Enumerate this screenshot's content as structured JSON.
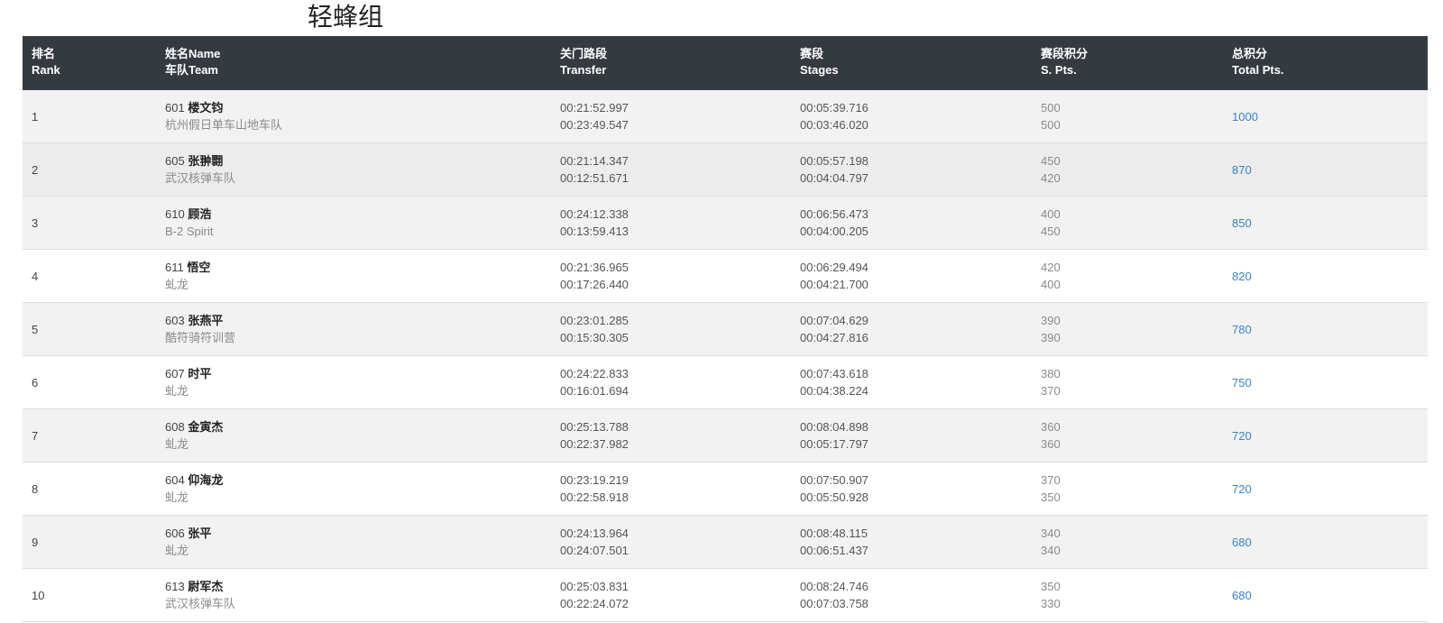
{
  "page": {
    "title": "轻蜂组"
  },
  "columns": {
    "rank_cn": "排名",
    "rank_en": "Rank",
    "name_cn": "姓名Name",
    "team_cn": "车队Team",
    "transfer_cn": "关门路段",
    "transfer_en": "Transfer",
    "stages_cn": "赛段",
    "stages_en": "Stages",
    "spts_cn": "赛段积分",
    "spts_en": "S. Pts.",
    "total_cn": "总积分",
    "total_en": "Total Pts."
  },
  "colors": {
    "header_bg": "#343a40",
    "link": "#3b82c4",
    "row_shade": "#f2f2f2"
  },
  "rows": [
    {
      "rank": "1",
      "bib": "601",
      "name": "楼文钧",
      "team": "杭州假日单车山地车队",
      "transfer1": "00:21:52.997",
      "transfer2": "00:23:49.547",
      "stage1": "00:05:39.716",
      "stage2": "00:03:46.020",
      "spts1": "500",
      "spts2": "500",
      "total": "1000"
    },
    {
      "rank": "2",
      "bib": "605",
      "name": "张翀翾",
      "team": "武汉核弹车队",
      "transfer1": "00:21:14.347",
      "transfer2": "00:12:51.671",
      "stage1": "00:05:57.198",
      "stage2": "00:04:04.797",
      "spts1": "450",
      "spts2": "420",
      "total": "870"
    },
    {
      "rank": "3",
      "bib": "610",
      "name": "顾浩",
      "team": "B-2 Spirit",
      "transfer1": "00:24:12.338",
      "transfer2": "00:13:59.413",
      "stage1": "00:06:56.473",
      "stage2": "00:04:00.205",
      "spts1": "400",
      "spts2": "450",
      "total": "850"
    },
    {
      "rank": "4",
      "bib": "611",
      "name": "悟空",
      "team": "虬龙",
      "transfer1": "00:21:36.965",
      "transfer2": "00:17:26.440",
      "stage1": "00:06:29.494",
      "stage2": "00:04:21.700",
      "spts1": "420",
      "spts2": "400",
      "total": "820"
    },
    {
      "rank": "5",
      "bib": "603",
      "name": "张燕平",
      "team": "酷符骑符训营",
      "transfer1": "00:23:01.285",
      "transfer2": "00:15:30.305",
      "stage1": "00:07:04.629",
      "stage2": "00:04:27.816",
      "spts1": "390",
      "spts2": "390",
      "total": "780"
    },
    {
      "rank": "6",
      "bib": "607",
      "name": "时平",
      "team": "虬龙",
      "transfer1": "00:24:22.833",
      "transfer2": "00:16:01.694",
      "stage1": "00:07:43.618",
      "stage2": "00:04:38.224",
      "spts1": "380",
      "spts2": "370",
      "total": "750"
    },
    {
      "rank": "7",
      "bib": "608",
      "name": "金寅杰",
      "team": "虬龙",
      "transfer1": "00:25:13.788",
      "transfer2": "00:22:37.982",
      "stage1": "00:08:04.898",
      "stage2": "00:05:17.797",
      "spts1": "360",
      "spts2": "360",
      "total": "720"
    },
    {
      "rank": "8",
      "bib": "604",
      "name": "仰海龙",
      "team": "虬龙",
      "transfer1": "00:23:19.219",
      "transfer2": "00:22:58.918",
      "stage1": "00:07:50.907",
      "stage2": "00:05:50.928",
      "spts1": "370",
      "spts2": "350",
      "total": "720"
    },
    {
      "rank": "9",
      "bib": "606",
      "name": "张平",
      "team": "虬龙",
      "transfer1": "00:24:13.964",
      "transfer2": "00:24:07.501",
      "stage1": "00:08:48.115",
      "stage2": "00:06:51.437",
      "spts1": "340",
      "spts2": "340",
      "total": "680"
    },
    {
      "rank": "10",
      "bib": "613",
      "name": "尉军杰",
      "team": "武汉核弹车队",
      "transfer1": "00:25:03.831",
      "transfer2": "00:22:24.072",
      "stage1": "00:08:24.746",
      "stage2": "00:07:03.758",
      "spts1": "350",
      "spts2": "330",
      "total": "680"
    }
  ]
}
